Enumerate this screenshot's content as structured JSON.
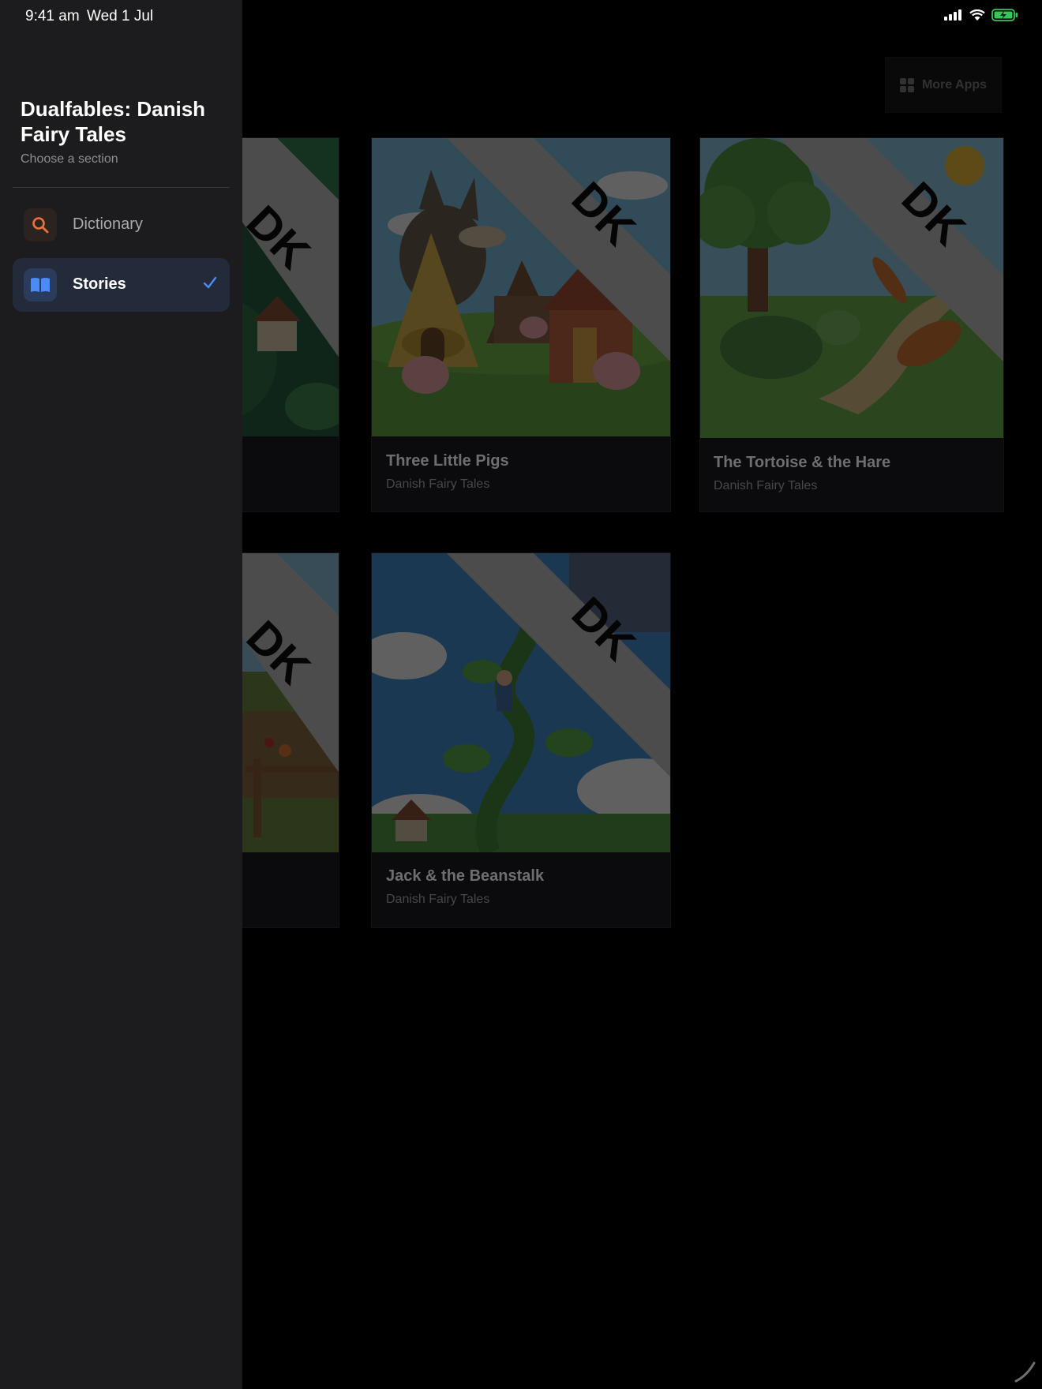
{
  "status_bar": {
    "time": "9:41 am",
    "date": "Wed 1 Jul",
    "battery_color": "#34c759"
  },
  "sidebar": {
    "app_title": "Dualfables: Danish Fairy Tales",
    "subtitle": "Choose a section",
    "items": [
      {
        "label": "Dictionary",
        "icon": "magnifying-glass-icon",
        "accent": "#e8743b",
        "selected": false
      },
      {
        "label": "Stories",
        "icon": "book-icon",
        "accent": "#4a8cf7",
        "selected": true
      }
    ]
  },
  "toolbar": {
    "more_apps_label": "More Apps",
    "more_apps_icon": "grid-icon"
  },
  "badge_text": "DK",
  "stories": [
    {
      "title": "",
      "subtitle": "",
      "partially_hidden": true
    },
    {
      "title": "Three Little Pigs",
      "subtitle": "Danish Fairy Tales"
    },
    {
      "title": "The Tortoise & the Hare",
      "subtitle": "Danish Fairy Tales"
    },
    {
      "title": "",
      "subtitle": "",
      "partially_hidden": true
    },
    {
      "title": "Jack & the Beanstalk",
      "subtitle": "Danish Fairy Tales"
    }
  ],
  "colors": {
    "sidebar_bg": "#1c1c1e",
    "selected_bg": "#232a3a",
    "accent_blue": "#4a8cf7",
    "accent_orange": "#e8743b"
  }
}
